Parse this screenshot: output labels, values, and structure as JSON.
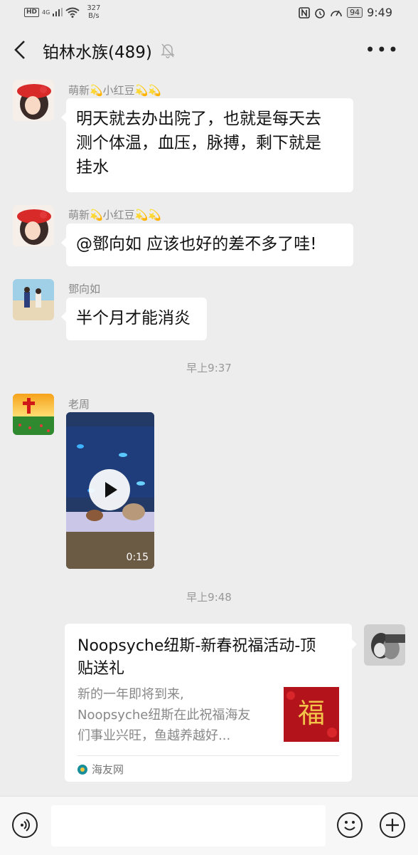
{
  "status_bar": {
    "hd": "HD",
    "network": "4G",
    "speed": "327",
    "speed_unit": "B/s",
    "battery": "94",
    "time": "9:49"
  },
  "header": {
    "title": "铂林水族(489)"
  },
  "messages": [
    {
      "sender": "萌新💫小红豆💫💫",
      "text_lines": [
        "明天就去办出院了，也就是每天去",
        "测个体温，血压，脉搏，剩下就是",
        "挂水"
      ]
    },
    {
      "sender": "萌新💫小红豆💫💫",
      "text": "@鄧向如  应该也好的差不多了哇!"
    },
    {
      "sender": "鄧向如",
      "text": "半个月才能消炎"
    },
    {
      "sender": "老周",
      "video_duration": "0:15"
    }
  ],
  "timestamps": [
    "早上9:37",
    "早上9:48"
  ],
  "card": {
    "title_lines": [
      "Noopsyche纽斯-新春祝福活动-顶",
      "贴送礼"
    ],
    "desc_lines": [
      "新的一年即将到来,",
      "Noopsyche纽斯在此祝福海友",
      "们事业兴旺，鱼越养越好..."
    ],
    "thumb_char": "福",
    "source": "海友网"
  },
  "colors": {
    "background": "#ededed",
    "bubble": "#ffffff",
    "card_thumb": "#b3131a"
  }
}
